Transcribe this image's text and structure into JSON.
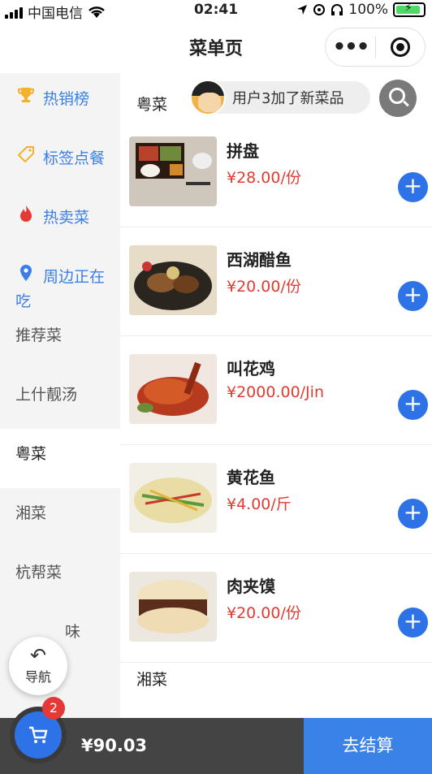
{
  "status_bar": {
    "carrier": "中国电信",
    "time": "02:41",
    "battery": "100%"
  },
  "nav": {
    "title": "菜单页",
    "more_icon": "more-dots-icon",
    "target_icon": "target-icon"
  },
  "sidebar": {
    "items": [
      {
        "label": "热销榜",
        "icon": "trophy-icon",
        "special": true
      },
      {
        "label": "标签点餐",
        "icon": "tag-icon",
        "special": true
      },
      {
        "label": "热卖菜",
        "icon": "fire-icon",
        "special": true
      },
      {
        "label": "周边正在吃",
        "icon": "location-pin-icon",
        "special": true
      },
      {
        "label": "推荐菜"
      },
      {
        "label": "上什靓汤"
      },
      {
        "label": "粤菜",
        "active": true
      },
      {
        "label": "湘菜"
      },
      {
        "label": "杭帮菜"
      },
      {
        "label": "味"
      }
    ],
    "nav_button_label": "导航"
  },
  "main": {
    "category_title": "粤菜",
    "notice_text": "用户3加了新菜品",
    "next_category_title": "湘菜",
    "dishes": [
      {
        "name": "拼盘",
        "price": "¥28.00/份"
      },
      {
        "name": "西湖醋鱼",
        "price": "¥20.00/份"
      },
      {
        "name": "叫花鸡",
        "price": "¥2000.00/Jin"
      },
      {
        "name": "黄花鱼",
        "price": "¥4.00/斤"
      },
      {
        "name": "肉夹馍",
        "price": "¥20.00/份"
      }
    ]
  },
  "cart": {
    "badge_count": "2",
    "total": "¥90.03",
    "checkout_label": "去结算"
  },
  "colors": {
    "accent": "#2d72e6",
    "price": "#e03c31",
    "cart_bar": "#444444",
    "checkout": "#3b82e8"
  }
}
